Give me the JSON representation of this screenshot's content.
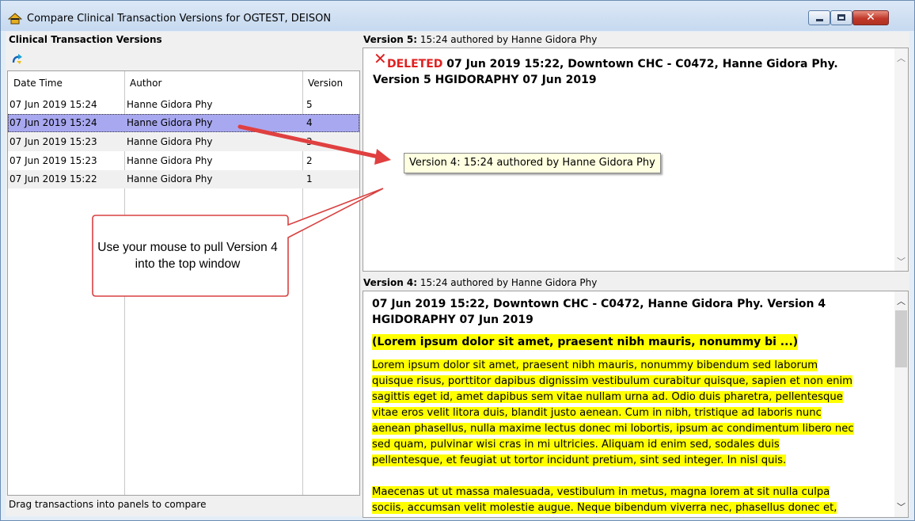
{
  "window": {
    "title": "Compare Clinical Transaction Versions for OGTEST, DEISON",
    "close_label": "✕"
  },
  "left": {
    "header": "Clinical Transaction Versions",
    "columns": [
      "Date Time",
      "Author",
      "Version"
    ],
    "rows": [
      {
        "datetime": "07 Jun 2019 15:24",
        "author": "Hanne Gidora Phy",
        "version": "5"
      },
      {
        "datetime": "07 Jun 2019 15:24",
        "author": "Hanne Gidora Phy",
        "version": "4"
      },
      {
        "datetime": "07 Jun 2019 15:23",
        "author": "Hanne Gidora Phy",
        "version": "3"
      },
      {
        "datetime": "07 Jun 2019 15:23",
        "author": "Hanne Gidora Phy",
        "version": "2"
      },
      {
        "datetime": "07 Jun 2019 15:22",
        "author": "Hanne Gidora Phy",
        "version": "1"
      }
    ],
    "status": "Drag transactions into panels to compare"
  },
  "top_panel": {
    "label_bold": "Version 5:",
    "label_rest": " 15:24 authored by Hanne Gidora Phy",
    "deleted": "DELETED",
    "text": " 07 Jun 2019 15:22, Downtown CHC - C0472, Hanne Gidora Phy. Version 5 HGIDORAPHY 07 Jun 2019"
  },
  "bottom_panel": {
    "label_bold": "Version 4:",
    "label_rest": " 15:24 authored by Hanne Gidora Phy",
    "heading": "07 Jun 2019 15:22, Downtown CHC - C0472, Hanne Gidora Phy.  Version 4 HGIDORAPHY 07 Jun 2019",
    "subheading": "(Lorem ipsum dolor sit amet, praesent nibh mauris, nonummy bi ...)",
    "para1_lines": [
      "Lorem ipsum dolor sit amet, praesent nibh mauris, nonummy bibendum sed laborum",
      "quisque risus, porttitor dapibus dignissim vestibulum curabitur quisque, sapien et non enim",
      "sagittis eget id, amet dapibus sem vitae nullam urna ad. Odio duis pharetra, pellentesque",
      "vitae eros velit litora duis, blandit justo aenean. Cum in nibh, tristique ad laboris nunc",
      "aenean phasellus, nulla maxime lectus donec mi lobortis, ipsum ac condimentum libero nec",
      "sed quam, pulvinar wisi cras in mi ultricies. Aliquam id enim sed, sodales duis",
      "pellentesque, et feugiat ut tortor incidunt pretium, sint sed integer. In nisl quis."
    ],
    "para2_lines": [
      "Maecenas ut ut massa malesuada, vestibulum in metus, magna lorem at sit nulla culpa",
      "sociis, accumsan velit molestie augue. Neque bibendum viverra nec, phasellus donec et,"
    ]
  },
  "tooltip": "Version 4: 15:24 authored by Hanne Gidora Phy",
  "callout": "Use your mouse to pull Version 4 into the top window",
  "colors": {
    "selected_row": "#a8a8f0",
    "highlight": "#ffff00",
    "deleted": "#e02020",
    "annotation": "#e04040"
  }
}
